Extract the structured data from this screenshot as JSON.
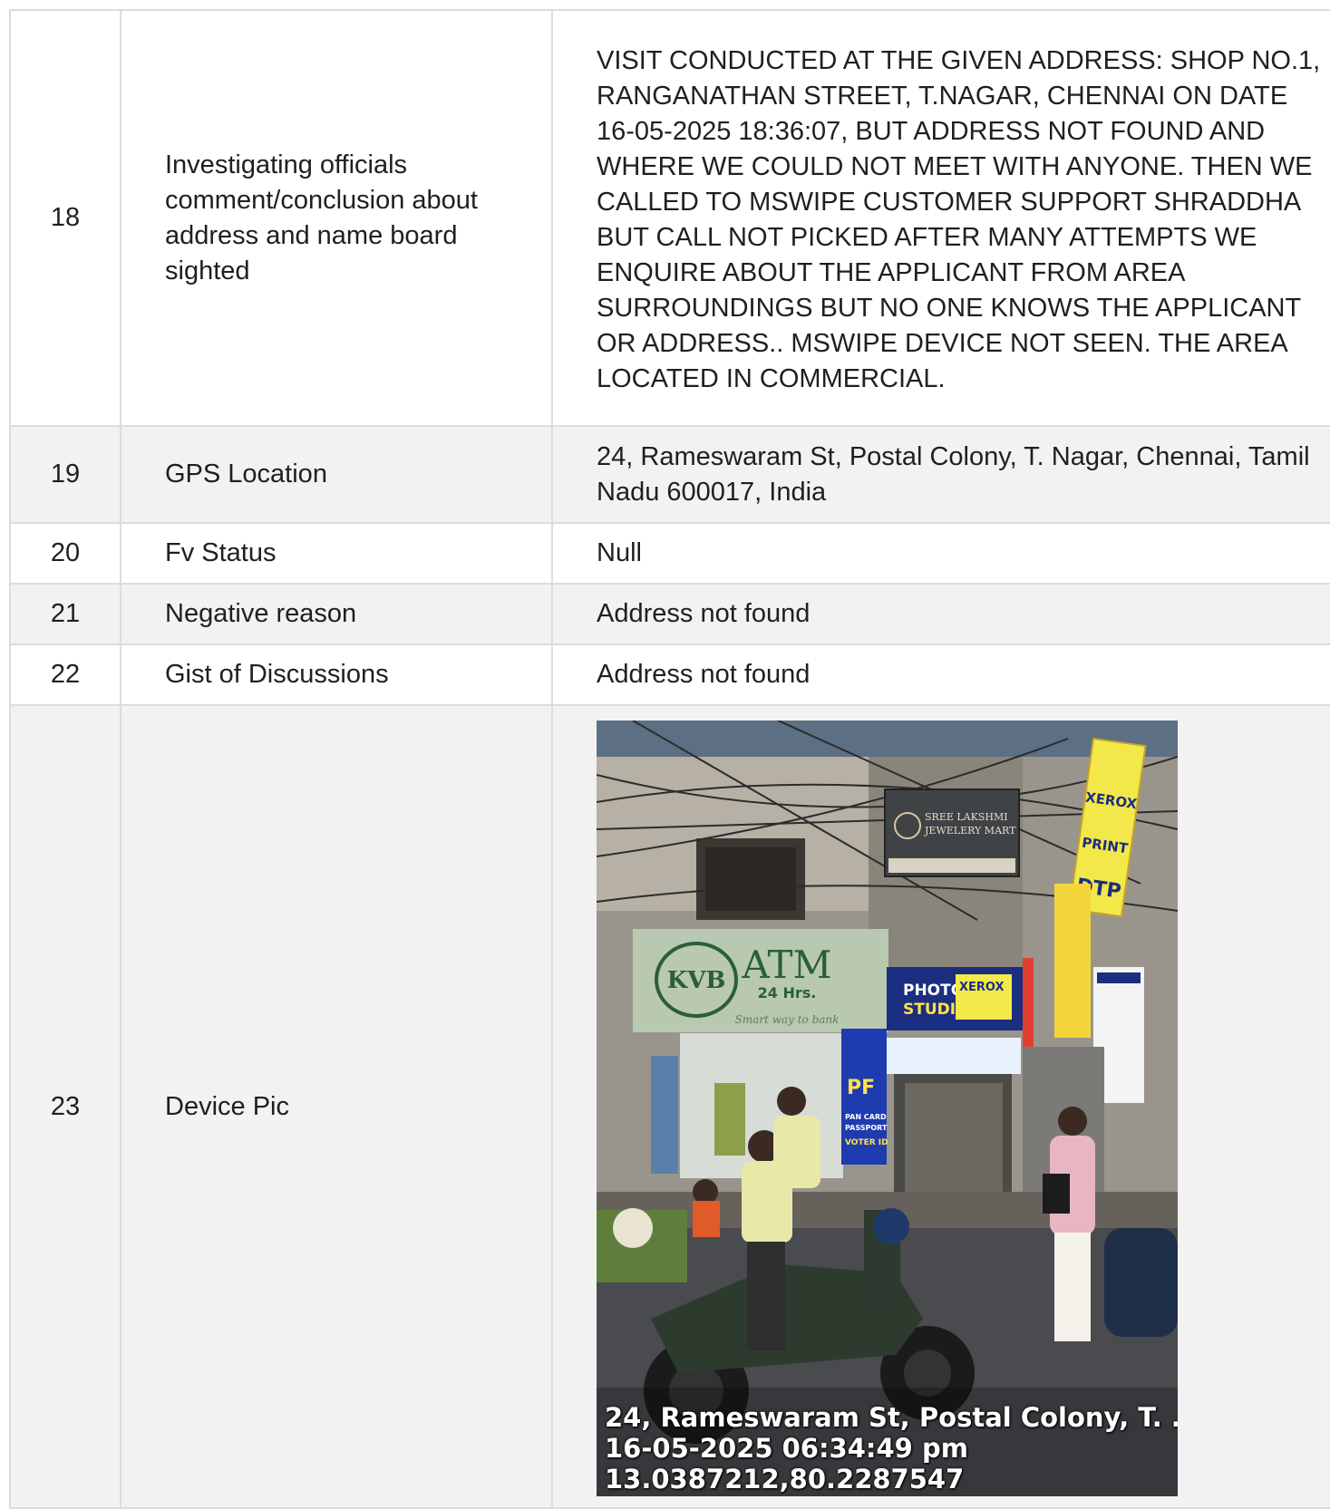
{
  "rows": [
    {
      "no": "18",
      "label": "Investigating officials comment/conclusion about address and name board sighted",
      "value": "VISIT CONDUCTED AT THE GIVEN ADDRESS: SHOP NO.1, RANGANATHAN STREET, T.NAGAR, CHENNAI ON DATE 16-05-2025 18:36:07, BUT ADDRESS NOT FOUND AND WHERE WE COULD NOT MEET WITH ANYONE. THEN WE CALLED TO MSWIPE CUSTOMER SUPPORT SHRADDHA BUT CALL NOT PICKED AFTER MANY ATTEMPTS WE ENQUIRE ABOUT THE APPLICANT FROM AREA SURROUNDINGS BUT NO ONE KNOWS THE APPLICANT OR ADDRESS.. MSWIPE DEVICE NOT SEEN. THE AREA LOCATED IN COMMERCIAL."
    },
    {
      "no": "19",
      "label": "GPS Location",
      "value": "24, Rameswaram St, Postal Colony, T. Nagar, Chennai, Tamil Nadu 600017, India"
    },
    {
      "no": "20",
      "label": "Fv Status",
      "value": "Null"
    },
    {
      "no": "21",
      "label": "Negative reason",
      "value": "Address not found"
    },
    {
      "no": "22",
      "label": "Gist of Discussions",
      "value": "Address not found"
    },
    {
      "no": "23",
      "label": "Device Pic",
      "value": ""
    }
  ],
  "device_pic": {
    "caption_line_1": "24, Rameswaram St, Postal Colony, T. ...",
    "caption_line_2": "16-05-2025 06:34:49 pm",
    "caption_line_3": "13.0387212,80.2287547",
    "signs": {
      "atm": "ATM",
      "atm_hours": "24 Hrs.",
      "bank": "KVB",
      "tagline": "Smart way to bank",
      "jewelers_1": "SREE LAKSHMI",
      "jewelers_2": "JEWELERY MART",
      "photo": "PHOTO",
      "studio": "STUDIO",
      "xerox": "XEROX",
      "print": "PRINT",
      "dtp": "DTP",
      "pf": "PF",
      "pan": "PAN CARD",
      "passport": "PASSPORT",
      "voter": "VOTER ID"
    }
  }
}
